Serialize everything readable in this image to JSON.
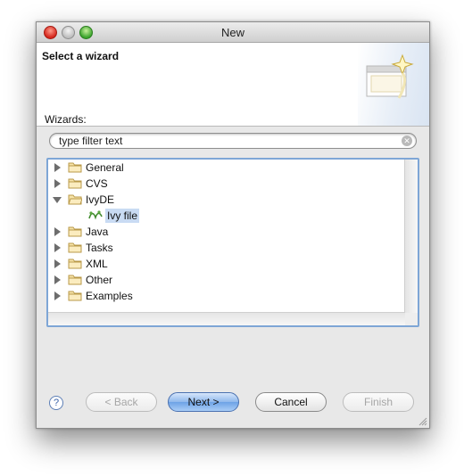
{
  "window": {
    "title": "New"
  },
  "banner": {
    "title": "Select a wizard"
  },
  "wizards_label": "Wizards:",
  "filter": {
    "value": "type filter text"
  },
  "tree": [
    {
      "label": "General",
      "expanded": false
    },
    {
      "label": "CVS",
      "expanded": false
    },
    {
      "label": "IvyDE",
      "expanded": true,
      "children": [
        {
          "label": "Ivy file",
          "selected": true
        }
      ]
    },
    {
      "label": "Java",
      "expanded": false
    },
    {
      "label": "Tasks",
      "expanded": false
    },
    {
      "label": "XML",
      "expanded": false
    },
    {
      "label": "Other",
      "expanded": false
    },
    {
      "label": "Examples",
      "expanded": false
    }
  ],
  "buttons": {
    "help": "?",
    "back": "< Back",
    "next": "Next >",
    "cancel": "Cancel",
    "finish": "Finish"
  },
  "colors": {
    "selection": "#c9dbf3",
    "focus_border": "#7ea6d6",
    "default_button": "#6da2e6"
  }
}
